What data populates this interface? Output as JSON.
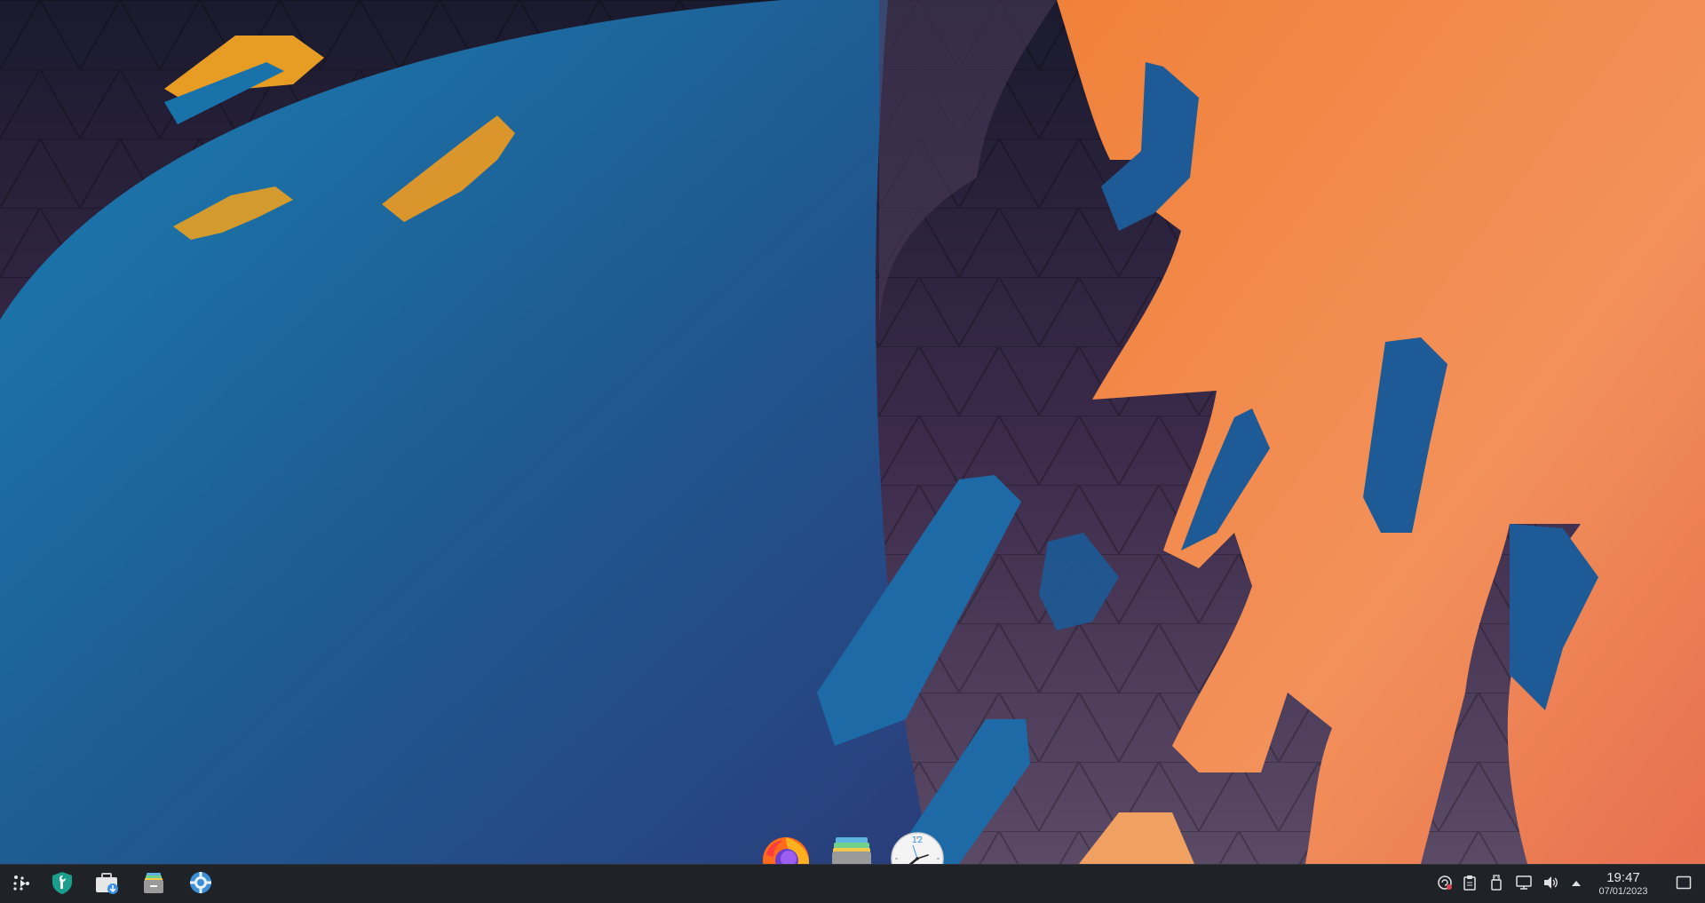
{
  "desktop": {
    "wallpaper_name": "KDE Plasma abstract wallpaper",
    "colors": {
      "blue": "#1d5a96",
      "orange": "#f28a4c",
      "yellow": "#f2a324",
      "sky": "#3a2d4c",
      "panel": "#1f2227"
    }
  },
  "dock": {
    "apps": [
      {
        "id": "firefox",
        "icon": "firefox-icon",
        "label": "Firefox"
      },
      {
        "id": "archive",
        "icon": "archive-manager-icon",
        "label": "Archive Manager"
      },
      {
        "id": "clock",
        "icon": "analog-clock-icon",
        "label": "Clock",
        "clock_numeral": "12"
      }
    ]
  },
  "panel": {
    "launchers": [
      {
        "id": "app-launcher",
        "icon": "application-launcher-icon"
      },
      {
        "id": "settings-tool",
        "icon": "wrench-shield-icon"
      },
      {
        "id": "discover",
        "icon": "discover-briefcase-icon"
      },
      {
        "id": "archive",
        "icon": "archive-box-icon"
      },
      {
        "id": "system-settings",
        "icon": "system-settings-gear-icon"
      }
    ],
    "tray": [
      {
        "id": "updates",
        "icon": "update-notifier-icon"
      },
      {
        "id": "clipboard",
        "icon": "clipboard-icon"
      },
      {
        "id": "removable",
        "icon": "usb-drive-icon"
      },
      {
        "id": "network",
        "icon": "network-monitor-icon"
      },
      {
        "id": "volume",
        "icon": "volume-icon"
      },
      {
        "id": "expand",
        "icon": "chevron-up-icon"
      }
    ],
    "clock": {
      "time": "19:47",
      "date": "07/01/2023"
    },
    "show_desktop_icon": "show-desktop-icon"
  }
}
